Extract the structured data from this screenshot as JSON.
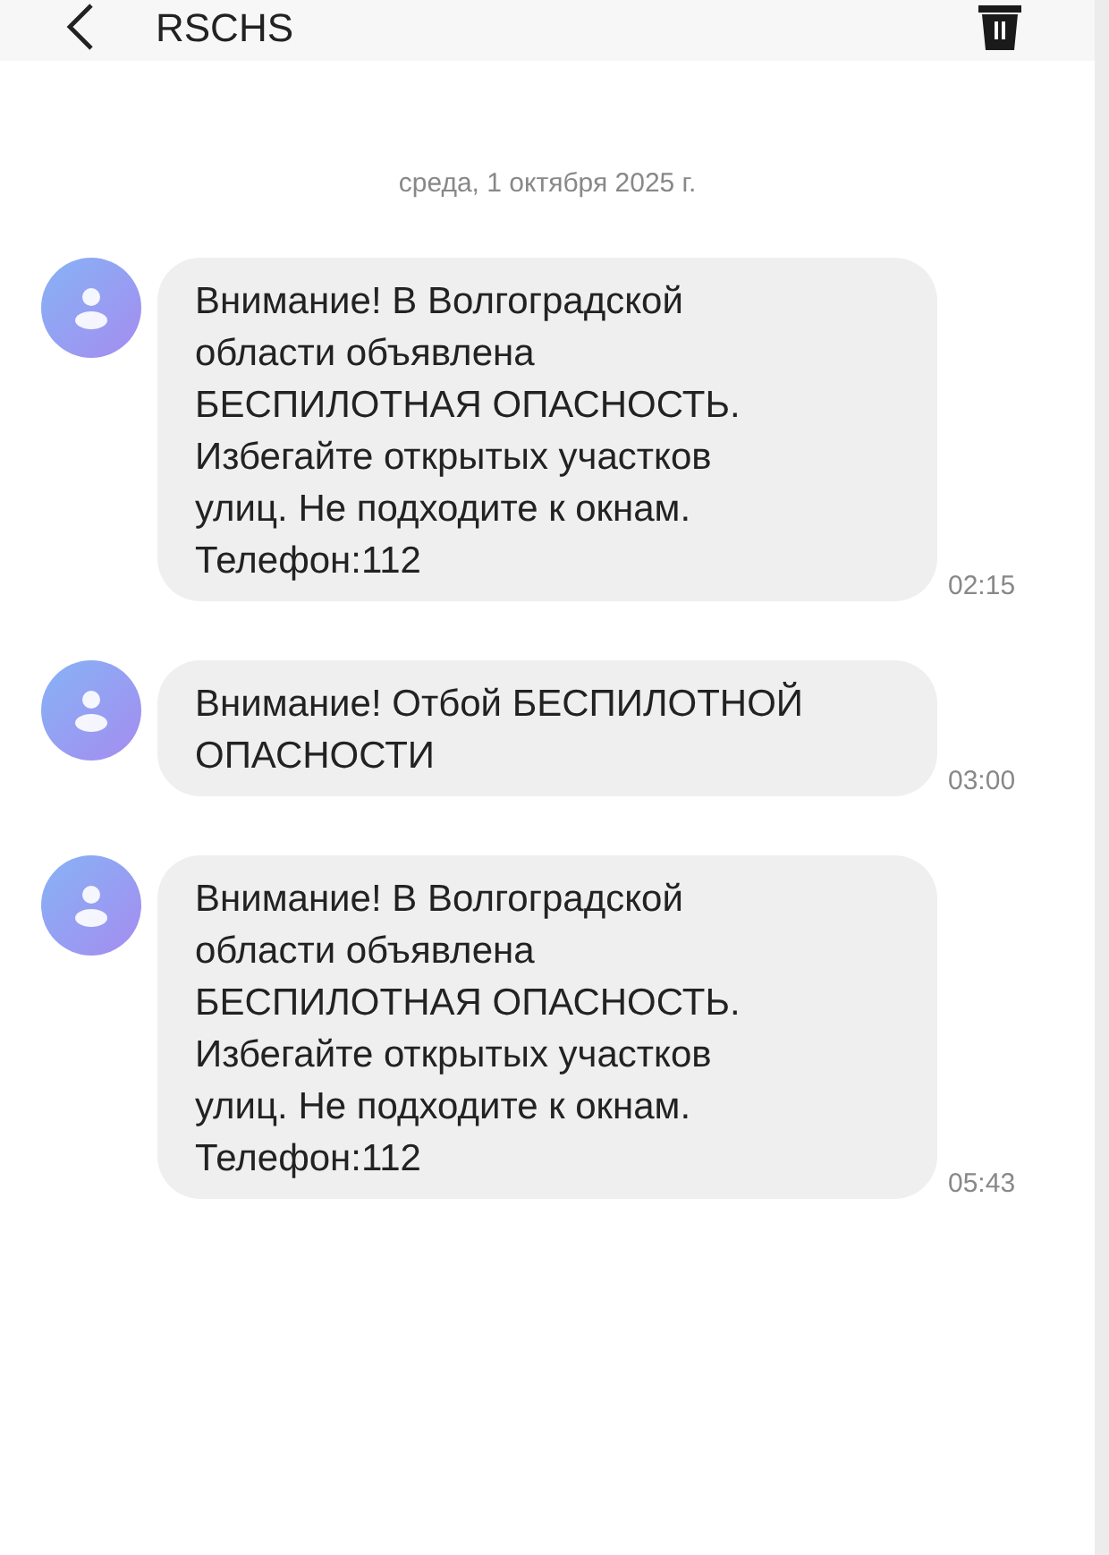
{
  "header": {
    "title": "RSCHS"
  },
  "date_divider": "среда, 1 октября 2025 г.",
  "messages": [
    {
      "text": "Внимание! В Волгоградской\nобласти объявлена\nБЕСПИЛОТНАЯ ОПАСНОСТЬ.\nИзбегайте открытых участков\nулиц. Не подходите к окнам.\nТелефон:112",
      "time": "02:15"
    },
    {
      "text": "Внимание! Отбой БЕСПИЛОТНОЙ\nОПАСНОСТИ",
      "time": "03:00"
    },
    {
      "text": "Внимание! В Волгоградской\nобласти объявлена\nБЕСПИЛОТНАЯ ОПАСНОСТЬ.\nИзбегайте открытых участков\nулиц. Не подходите к окнам.\nТелефон:112",
      "time": "05:43"
    }
  ]
}
